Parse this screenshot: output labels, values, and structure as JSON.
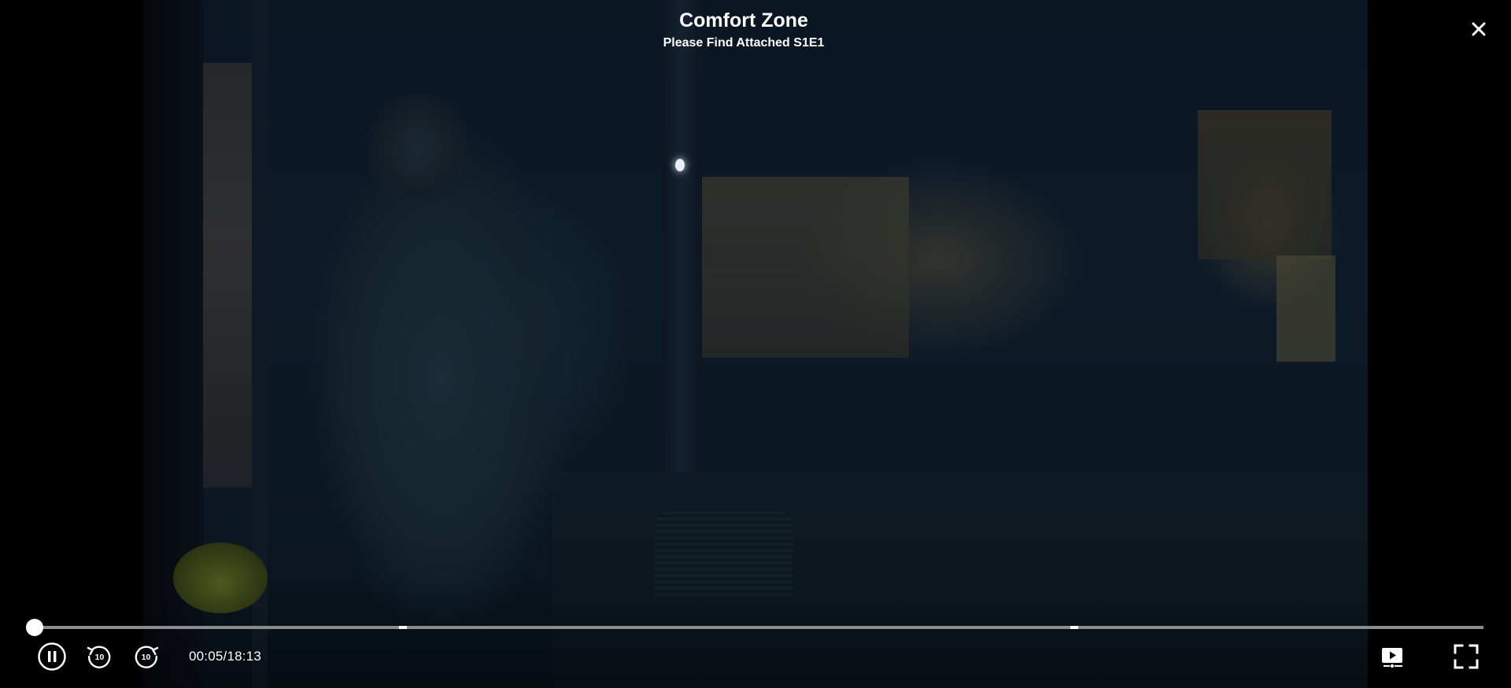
{
  "header": {
    "show_title": "Comfort Zone",
    "episode_title": "Please Find Attached S1E1"
  },
  "icons": {
    "close": "close-icon",
    "pause": "pause-icon",
    "rewind": "rewind-10-icon",
    "forward": "forward-10-icon",
    "next_episode": "next-episode-icon",
    "fullscreen": "fullscreen-icon"
  },
  "controls": {
    "rewind_seconds": "10",
    "forward_seconds": "10",
    "time_display": "00:05/18:13"
  },
  "playback": {
    "elapsed": "00:05",
    "duration": "18:13",
    "progress_fraction": 0.0046,
    "chapter_marker_fractions": [
      0.255,
      0.716
    ]
  },
  "colors": {
    "accent": "#e10a3c",
    "track": "#8a8d90",
    "text": "#ffffff"
  }
}
